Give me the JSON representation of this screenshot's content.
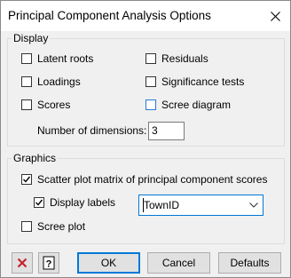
{
  "window": {
    "title": "Principal Component Analysis Options"
  },
  "display": {
    "group_label": "Display",
    "latent_roots": {
      "label": "Latent roots",
      "checked": false
    },
    "residuals": {
      "label": "Residuals",
      "checked": false
    },
    "loadings": {
      "label": "Loadings",
      "checked": false
    },
    "significance_tests": {
      "label": "Significance tests",
      "checked": false
    },
    "scores": {
      "label": "Scores",
      "checked": false
    },
    "scree_diagram": {
      "label": "Scree diagram",
      "checked": false
    },
    "num_dimensions": {
      "label": "Number of dimensions:",
      "value": "3"
    }
  },
  "graphics": {
    "group_label": "Graphics",
    "scatter_matrix": {
      "label": "Scatter plot matrix of principal component scores",
      "checked": true
    },
    "display_labels": {
      "label": "Display labels",
      "checked": true
    },
    "labels_select": {
      "value": "TownID"
    },
    "scree_plot": {
      "label": "Scree plot",
      "checked": false
    }
  },
  "buttons": {
    "clear_icon": "red-x-icon",
    "help_icon": "question-mark-icon",
    "ok": "OK",
    "cancel": "Cancel",
    "defaults": "Defaults"
  },
  "colors": {
    "accent": "#0078d7",
    "clear_red": "#c4262e"
  }
}
